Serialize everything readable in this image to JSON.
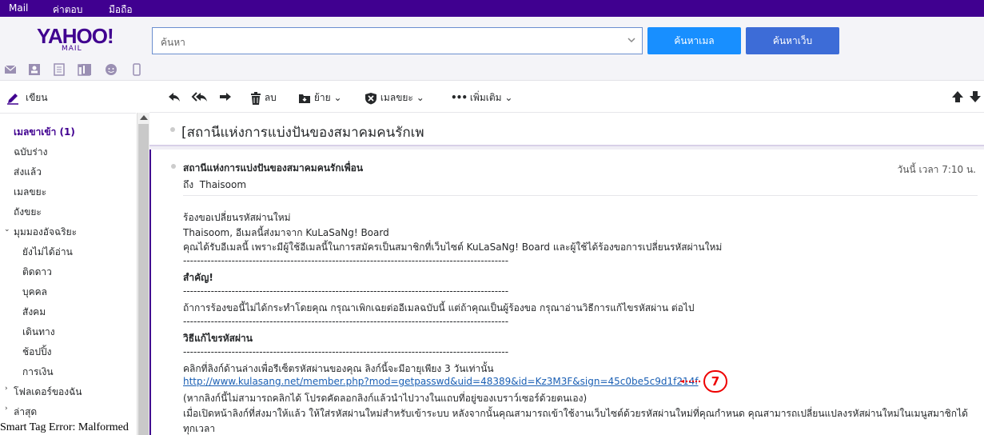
{
  "topbar": {
    "items": [
      "Mail",
      "ค่าตอบ",
      "มือถือ"
    ]
  },
  "header": {
    "logo": "YAHOO!",
    "logo_sub": "MAIL",
    "search_placeholder": "ค้นหา",
    "search_mail_label": "ค้นหาเมล",
    "search_web_label": "ค้นหาเว็บ"
  },
  "apps": [
    "mail-icon",
    "contacts-icon",
    "notepad-icon",
    "calendar-icon",
    "notes-icon",
    "messenger-icon",
    "mobile-icon"
  ],
  "compose_label": "เขียน",
  "nav": {
    "inbox": "เมลขาเข้า (1)",
    "drafts": "ฉบับร่าง",
    "sent": "ส่งแล้ว",
    "spam": "เมลขยะ",
    "trash": "ถังขยะ",
    "smart_views": "มุมมองอัจฉริยะ",
    "unread": "ยังไม่ได้อ่าน",
    "starred": "ติดดาว",
    "people": "บุคคล",
    "social": "สังคม",
    "travel": "เดินทาง",
    "shopping": "ช้อปปิ้ง",
    "finance": "การเงิน",
    "my_folders": "โฟลเดอร์ของฉัน",
    "recent": "ล่าสุด"
  },
  "smarttag_error": "Smart Tag Error: Malformed",
  "toolbar": {
    "delete": "ลบ",
    "move": "ย้าย",
    "spam": "เมลขยะ",
    "more": "เพิ่มเติม"
  },
  "message": {
    "subject": "[สถานีแห่งการแบ่งปันของสมาคมคนรักเพ",
    "sender": "สถานีแห่งการแบ่งปันของสมาคมคนรักเพื่อน",
    "to_prefix": "ถึง",
    "to_name": "Thaisoom",
    "date": "วันนี้ เวลา 7:10 น.",
    "body": {
      "l1": "ร้องขอเปลี่ยนรหัสผ่านใหม่",
      "l2": "Thaisoom, อีเมลนี้ส่งมาจาก KuLaSaNg! Board",
      "l3": "คุณได้รับอีเมลนี้ เพราะมีผู้ใช้อีเมลนี้ในการสมัครเป็นสมาชิกที่เว็บไซต์ KuLaSaNg! Board และผู้ใช้ได้ร้องขอการเปลี่ยนรหัสผ่านใหม่",
      "sep": "----------------------------------------------------------------------------------------------",
      "important": "สำคัญ!",
      "l5": "ถ้าการร้องขอนี้ไม่ได้กระทำโดยคุณ กรุณาเพิกเฉยต่ออีเมลฉบับนี้ แต่ถ้าคุณเป็นผู้ร้องขอ กรุณาอ่านวิธีการแก้ไขรหัสผ่าน ต่อไป",
      "howto": "วิธีแก้ไขรหัสผ่าน",
      "l7": "คลิกที่ลิงก์ด้านล่างเพื่อรีเซ็ตรหัสผ่านของคุณ ลิงก์นี้จะมีอายุเพียง 3 วันเท่านั้น",
      "link": "http://www.kulasang.net/member.php?mod=getpasswd&uid=48389&id=Kz3M3F&sign=45c0be5c9d1f214f",
      "l9": "(หากลิงก์นี้ไม่สามารถคลิกได้ โปรดคัดลอกลิงก์แล้วนำไปวางในแถบที่อยู่ของเบราว์เซอร์ด้วยตนเอง)",
      "l10": "เมื่อเปิดหน้าลิงก์ที่ส่งมาให้แล้ว ให้ใส่รหัสผ่านใหม่สำหรับเข้าระบบ หลังจากนั้นคุณสามารถเข้าใช้งานเว็บไซต์ด้วยรหัสผ่านใหม่ที่คุณกำหนด คุณสามารถเปลี่ยนแปลงรหัสผ่านใหม่ในเมนูสมาชิกได้",
      "l11": "ทุกเวลา"
    }
  },
  "callout_number": "7",
  "colors": {
    "brand": "#400090",
    "search_blue": "#188fff",
    "web_blue": "#3d6cd7",
    "callout_red": "#e00000"
  }
}
